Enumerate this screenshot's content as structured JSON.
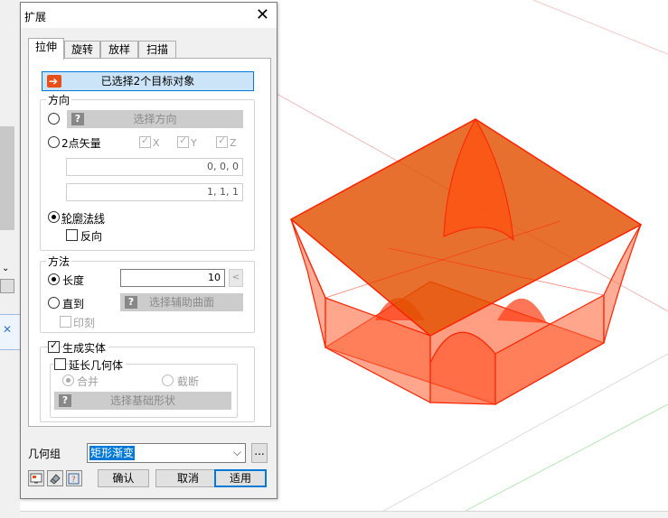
{
  "dialog": {
    "title": "扩展",
    "tabs": [
      "拉伸",
      "旋转",
      "放样",
      "扫描"
    ],
    "selected_targets_label": "已选择2个目标对象",
    "direction": {
      "group_label": "方向",
      "select_direction_label": "选择方向",
      "two_point_label": "2点矢量",
      "axis_x": "X",
      "axis_y": "Y",
      "axis_z": "Z",
      "point1": "0, 0, 0",
      "point2": "1, 1, 1",
      "profile_normal_label": "轮廓法线",
      "reverse_label": "反向"
    },
    "method": {
      "group_label": "方法",
      "length_label": "长度",
      "length_value": "10",
      "length_btn": "<",
      "up_to_label": "直到",
      "select_aux_surface_label": "选择辅助曲面",
      "imprint_label": "印刻"
    },
    "solid": {
      "generate_solid_label": "生成实体",
      "extend_geometry_label": "延长几何体",
      "merge_label": "合并",
      "cut_label": "截断",
      "select_base_shape_label": "选择基础形状"
    },
    "geometry_group_label": "几何组",
    "geometry_group_value": "矩形渐变",
    "more_label": "...",
    "ok_label": "确认",
    "cancel_label": "取消",
    "apply_label": "适用"
  },
  "colors": {
    "shape_fill": "#ff4a1c",
    "shape_edge": "#ff2200",
    "accent": "#0078d7"
  }
}
